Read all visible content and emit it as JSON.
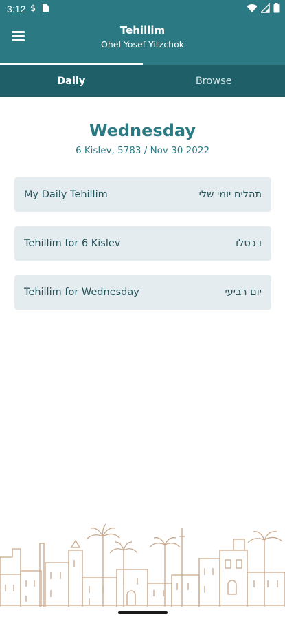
{
  "status_bar": {
    "time": "3:12",
    "icons": [
      "dollar-notification-icon",
      "sim-card-icon",
      "wifi-icon",
      "signal-icon",
      "battery-icon"
    ]
  },
  "app_bar": {
    "title": "Tehillim",
    "subtitle": "Ohel Yosef Yitzchok",
    "menu_icon": "hamburger-menu-icon"
  },
  "tabs": [
    {
      "label": "Daily",
      "active": true
    },
    {
      "label": "Browse",
      "active": false
    }
  ],
  "today": {
    "day": "Wednesday",
    "date": "6 Kislev, 5783 / Nov 30 2022"
  },
  "cards": [
    {
      "label_en": "My Daily Tehillim",
      "label_he": "תהלים יומי שלי"
    },
    {
      "label_en": "Tehillim for 6 Kislev",
      "label_he": "ו כסלו"
    },
    {
      "label_en": "Tehillim for Wednesday",
      "label_he": "יום רביעי"
    }
  ],
  "colors": {
    "primary": "#2b7a83",
    "tab_bar": "#1f5f67",
    "card_bg": "#e4ecef",
    "card_text": "#24535a",
    "skyline": "#c9a88a"
  }
}
